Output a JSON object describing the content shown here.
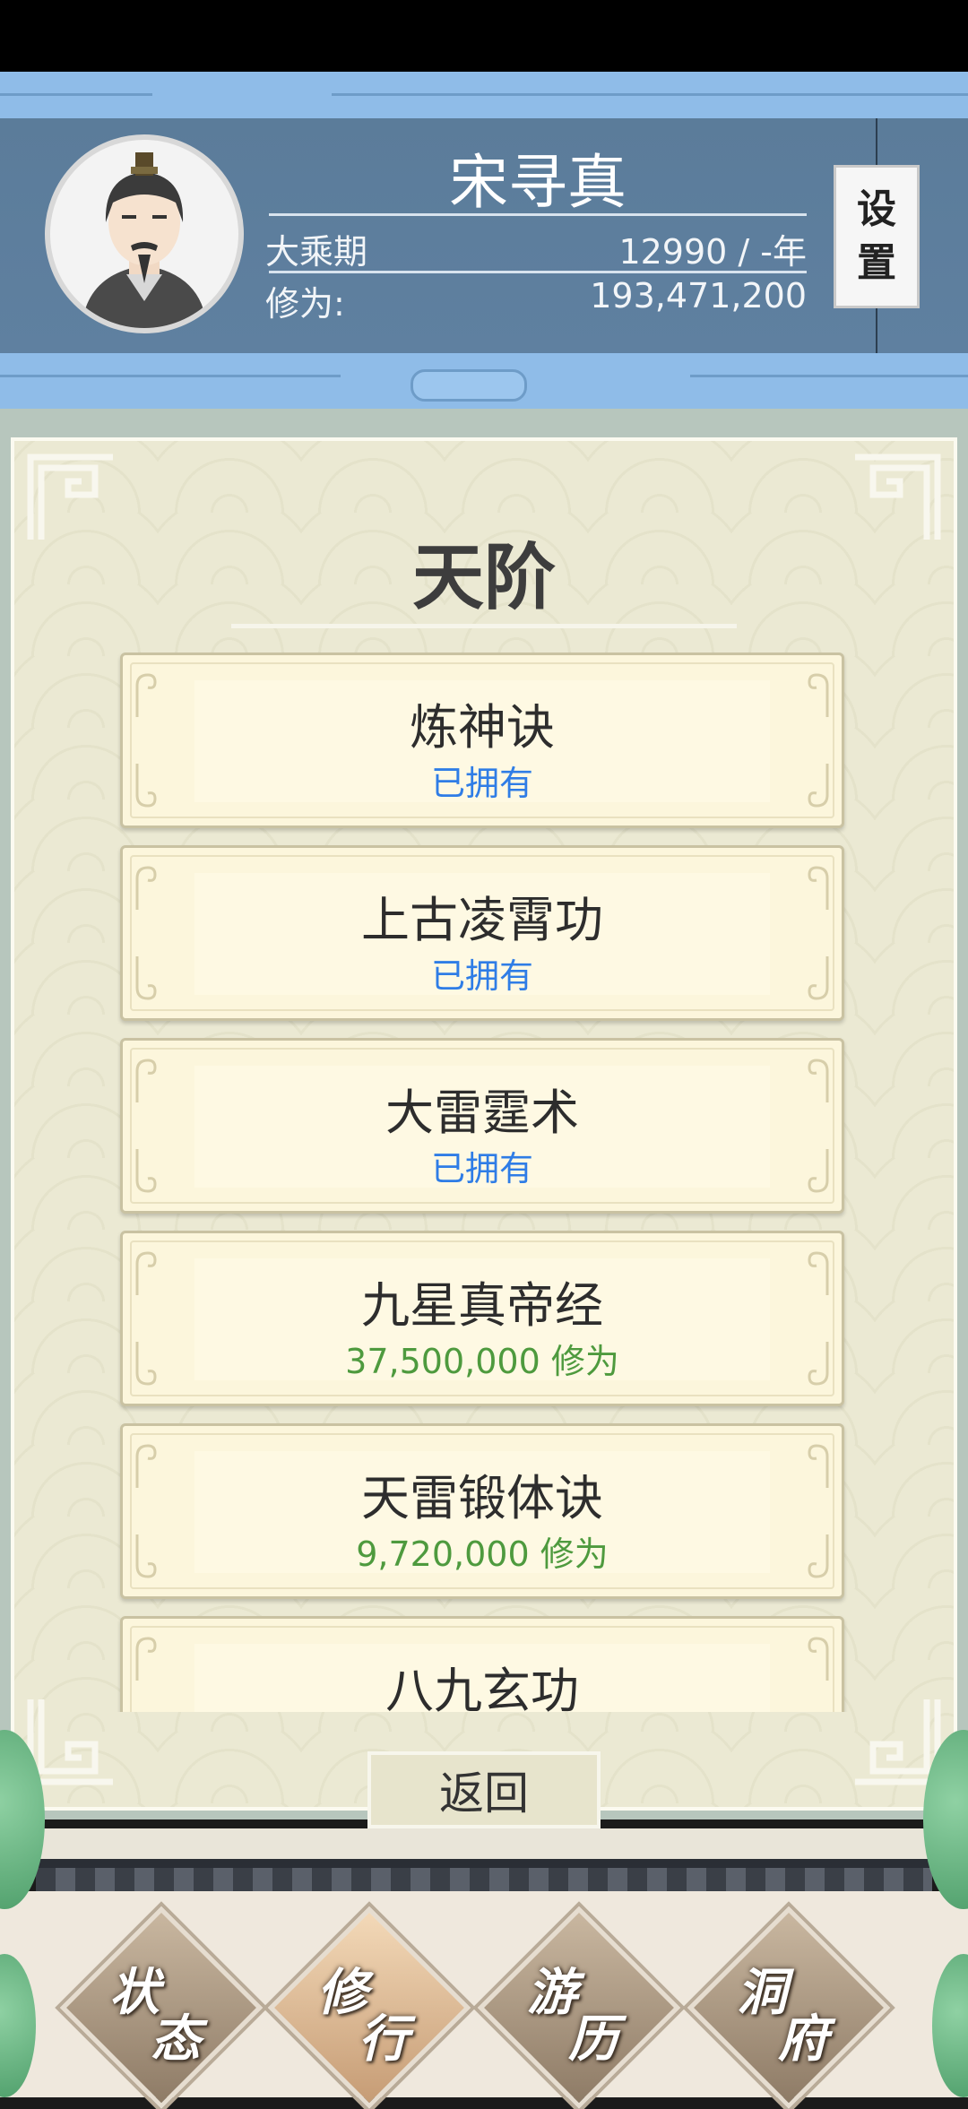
{
  "player": {
    "name": "宋寻真",
    "realm": "大乘期",
    "age_info": "12990 / -年",
    "cultivation_label": "修为:",
    "cultivation_value": "193,471,200"
  },
  "settings": {
    "char1": "设",
    "char2": "置"
  },
  "panel": {
    "title": "天阶",
    "skills": [
      {
        "name": "炼神诀",
        "status": "已拥有",
        "kind": "owned"
      },
      {
        "name": "上古凌霄功",
        "status": "已拥有",
        "kind": "owned"
      },
      {
        "name": "大雷霆术",
        "status": "已拥有",
        "kind": "owned"
      },
      {
        "name": "九星真帝经",
        "status": "37,500,000 修为",
        "kind": "cost"
      },
      {
        "name": "天雷锻体诀",
        "status": "9,720,000 修为",
        "kind": "cost"
      },
      {
        "name": "八九玄功",
        "status": "",
        "kind": "cost"
      }
    ],
    "back_label": "返回"
  },
  "nav": {
    "items": [
      {
        "c1": "状",
        "c2": "态"
      },
      {
        "c1": "修",
        "c2": "行"
      },
      {
        "c1": "游",
        "c2": "历"
      },
      {
        "c1": "洞",
        "c2": "府"
      }
    ],
    "active_index": 1
  },
  "colors": {
    "owned": "#2f7de6",
    "cost": "#4e9a3e",
    "header_bg": "#5b7c9a"
  }
}
